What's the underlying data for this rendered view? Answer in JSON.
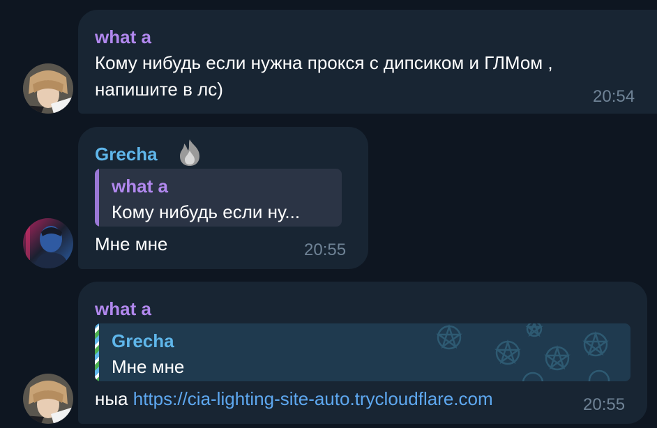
{
  "messages": [
    {
      "sender": "what a",
      "lines": [
        "Кому нибудь если нужна прокся с дипсиком и ГЛМом ,",
        "напишите в лс)"
      ],
      "time": "20:54"
    },
    {
      "sender": "Grecha",
      "reply": {
        "sender": "what a",
        "text": "Кому нибудь если ну..."
      },
      "text": "Мне мне",
      "time": "20:55"
    },
    {
      "sender": "what a",
      "reply": {
        "sender": "Grecha",
        "text": "Мне мне"
      },
      "text_prefix": "ныа",
      "link": "https://cia-lighting-site-auto.trycloudflare.com",
      "time": "20:55"
    }
  ],
  "colors": {
    "background": "#0e1621",
    "bubble": "#182533",
    "name_purple": "#b188ee",
    "name_blue": "#5fb6ea",
    "link": "#5ea8f0",
    "time": "#6f8396"
  },
  "icons": [
    "avatar-what-a",
    "avatar-grecha",
    "fire-emoji-icon",
    "pentagram-pattern"
  ]
}
